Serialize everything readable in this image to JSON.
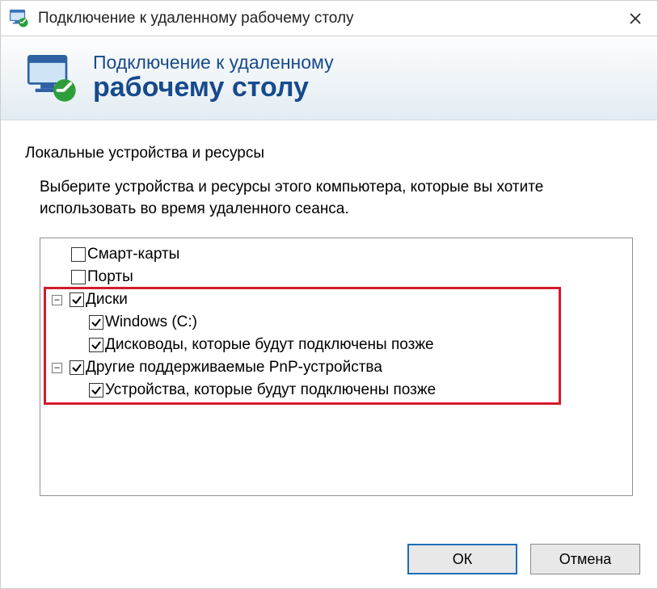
{
  "window": {
    "title": "Подключение к удаленному рабочему столу"
  },
  "banner": {
    "line1": "Подключение к удаленному",
    "line2": "рабочему столу"
  },
  "group": {
    "label": "Локальные устройства и ресурсы",
    "instructions": "Выберите устройства и ресурсы этого компьютера, которые вы хотите использовать во время удаленного сеанса."
  },
  "tree": {
    "smartcards": {
      "label": "Смарт-карты",
      "checked": false
    },
    "ports": {
      "label": "Порты",
      "checked": false
    },
    "drives": {
      "label": "Диски",
      "checked": true,
      "expander": "−",
      "children": {
        "c": {
          "label": "Windows (C:)",
          "checked": true
        },
        "later_drives": {
          "label": "Дисководы, которые будут подключены позже",
          "checked": true
        }
      }
    },
    "pnp": {
      "label": "Другие поддерживаемые PnP-устройства",
      "checked": true,
      "expander": "−",
      "children": {
        "later_pnp": {
          "label": "Устройства, которые будут подключены позже",
          "checked": true
        }
      }
    }
  },
  "buttons": {
    "ok": "ОК",
    "cancel": "Отмена"
  },
  "colors": {
    "highlight": "#d11b2b",
    "header_text": "#174a8c"
  }
}
